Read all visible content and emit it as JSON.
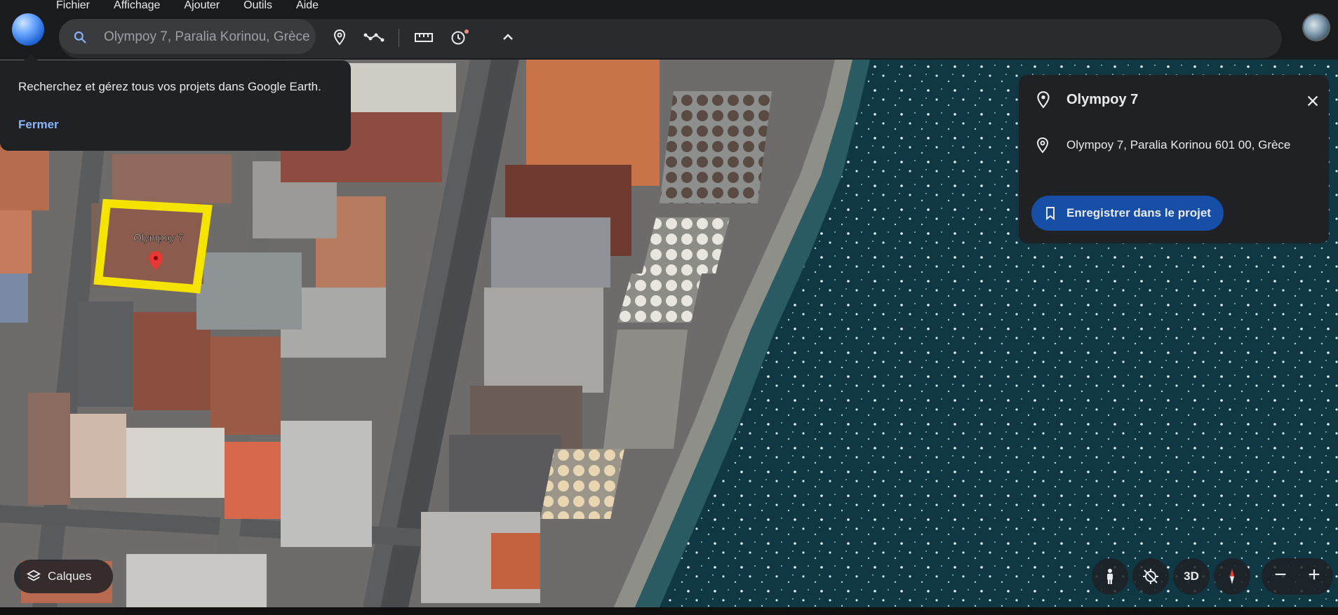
{
  "menu": [
    {
      "label": "Fichier"
    },
    {
      "label": "Affichage"
    },
    {
      "label": "Ajouter"
    },
    {
      "label": "Outils"
    },
    {
      "label": "Aide"
    }
  ],
  "search": {
    "value": "Olympoy 7, Paralia Korinou, Grèce"
  },
  "toolbar_icons": [
    "search-icon",
    "add-placemark-icon",
    "draw-path-icon",
    "measure-icon",
    "history-icon",
    "collapse-chevron-icon"
  ],
  "tooltip": {
    "text": "Recherchez et gérez tous vos projets dans Google Earth.",
    "close_label": "Fermer"
  },
  "map": {
    "placemark_label": "Olympoy 7",
    "highlight_color": "#f5e400",
    "sea_color": "#103a45"
  },
  "panel": {
    "title": "Olympoy 7",
    "address": "Olympoy 7, Paralia Korinou 601 00, Grèce",
    "save_label": "Enregistrer dans le projet"
  },
  "controls": {
    "layers_label": "Calques",
    "view_3d_label": "3D",
    "zoom_out_label": "−",
    "zoom_in_label": "+"
  }
}
